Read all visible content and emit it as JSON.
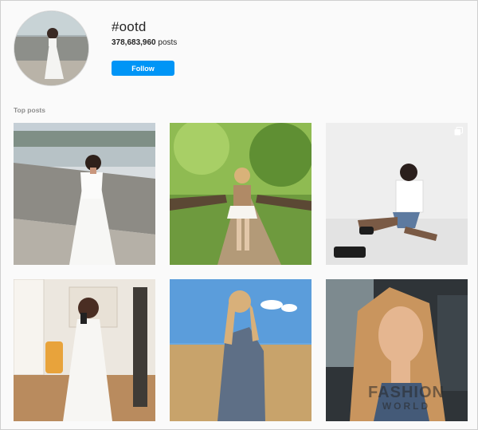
{
  "hashtag": {
    "title": "#ootd",
    "count": "378,683,960",
    "count_suffix": " posts"
  },
  "follow_label": "Follow",
  "section_label": "Top posts",
  "posts": [
    {
      "description": "woman in white dress by city river"
    },
    {
      "description": "woman on wooden forest bridge"
    },
    {
      "description": "woman sitting in white studio"
    },
    {
      "description": "woman taking mirror selfie in white dress"
    },
    {
      "description": "woman in grey bodysuit in field"
    },
    {
      "description": "woman selfie in car"
    }
  ],
  "watermark": {
    "line1": "FASHION",
    "line2": "WORLD"
  },
  "colors": {
    "accent": "#0095f6",
    "text": "#262626",
    "muted": "#8e8e8e"
  }
}
